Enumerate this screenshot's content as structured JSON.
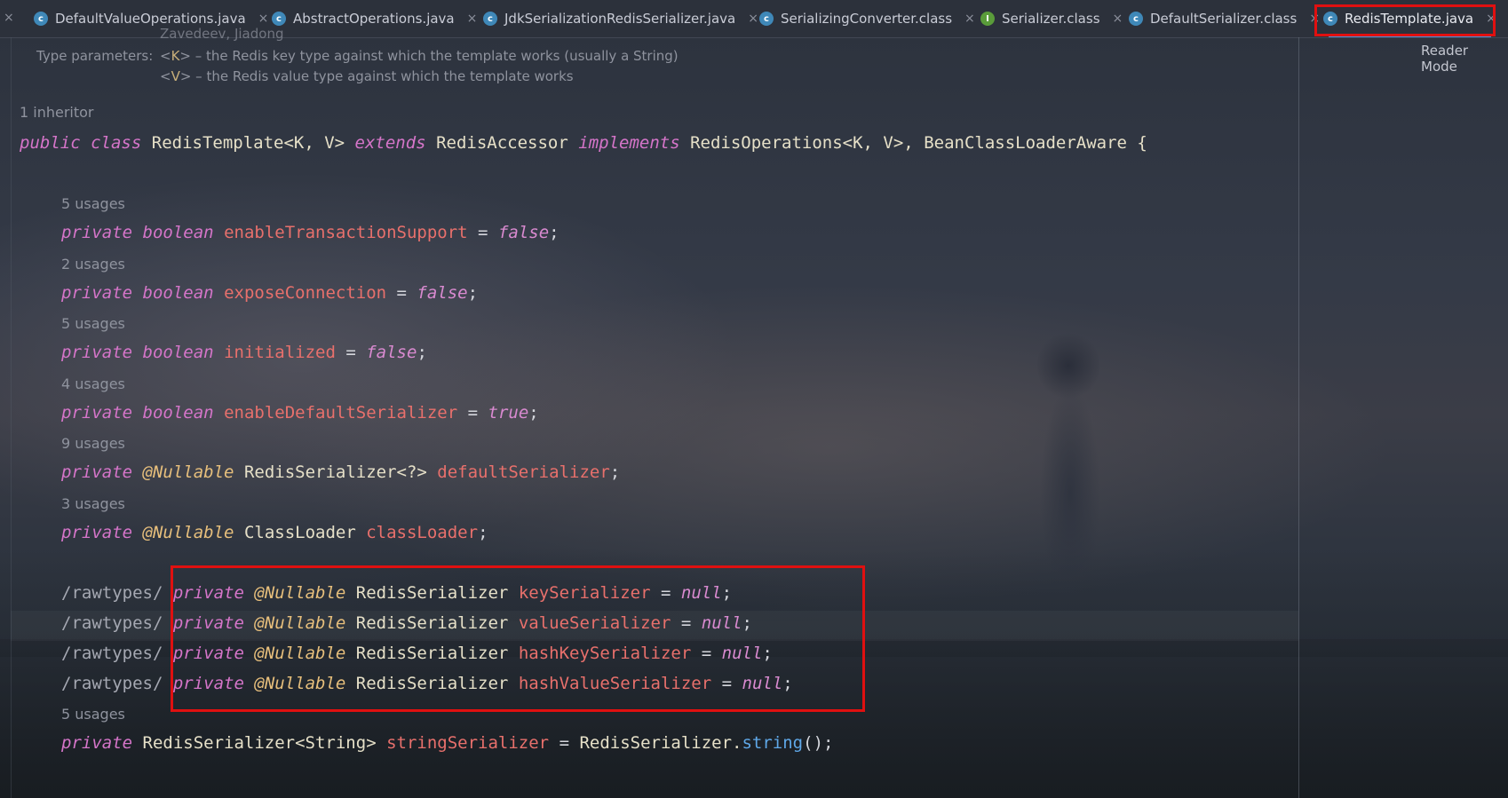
{
  "tabs": [
    {
      "label": "DefaultValueOperations.java",
      "icon": "c"
    },
    {
      "label": "AbstractOperations.java",
      "icon": "c"
    },
    {
      "label": "JdkSerializationRedisSerializer.java",
      "icon": "c"
    },
    {
      "label": "SerializingConverter.class",
      "icon": "c"
    },
    {
      "label": "Serializer.class",
      "icon": "i"
    },
    {
      "label": "DefaultSerializer.class",
      "icon": "c"
    },
    {
      "label": "RedisTemplate.java",
      "icon": "c",
      "active": true
    }
  ],
  "close_glyph": "×",
  "reader_mode": "Reader Mode",
  "doc": {
    "authors_partial": "Zavedeev, Jiadong",
    "type_params_label": "Type parameters:",
    "k_line": [
      "<",
      "K",
      "> – the Redis key type against which the template works (usually a String)"
    ],
    "v_line": [
      "<",
      "V",
      "> – the Redis value type against which the template works"
    ]
  },
  "inheritors": "1 inheritor",
  "class_decl": {
    "public": "public",
    "class": "class",
    "name": "RedisTemplate<K, V>",
    "extends": "extends",
    "parent": "RedisAccessor",
    "implements": "implements",
    "ifaces": "RedisOperations<K, V>, BeanClassLoaderAware {"
  },
  "fields": [
    {
      "usages": "5 usages",
      "type": "boolean",
      "name": "enableTransactionSupport",
      "value": "false"
    },
    {
      "usages": "2 usages",
      "type": "boolean",
      "name": "exposeConnection",
      "value": "false"
    },
    {
      "usages": "5 usages",
      "type": "boolean",
      "name": "initialized",
      "value": "false"
    },
    {
      "usages": "4 usages",
      "type": "boolean",
      "name": "enableDefaultSerializer",
      "value": "true"
    }
  ],
  "nullable_fields": [
    {
      "usages": "9 usages",
      "type": "RedisSerializer<?>",
      "name": "defaultSerializer"
    },
    {
      "usages": "3 usages",
      "type": "ClassLoader",
      "name": "classLoader"
    }
  ],
  "raw_fields": [
    {
      "name": "keySerializer"
    },
    {
      "name": "valueSerializer"
    },
    {
      "name": "hashKeySerializer"
    },
    {
      "name": "hashValueSerializer"
    }
  ],
  "raw_prefix": "/rawtypes/",
  "private": "private",
  "nullable": "@Nullable",
  "raw_type": "RedisSerializer",
  "null": "null",
  "string_field": {
    "usages": "5 usages",
    "type": "RedisSerializer<String>",
    "name": "stringSerializer",
    "rhs_class": "RedisSerializer.",
    "rhs_method": "string",
    "rhs_end": "();"
  }
}
